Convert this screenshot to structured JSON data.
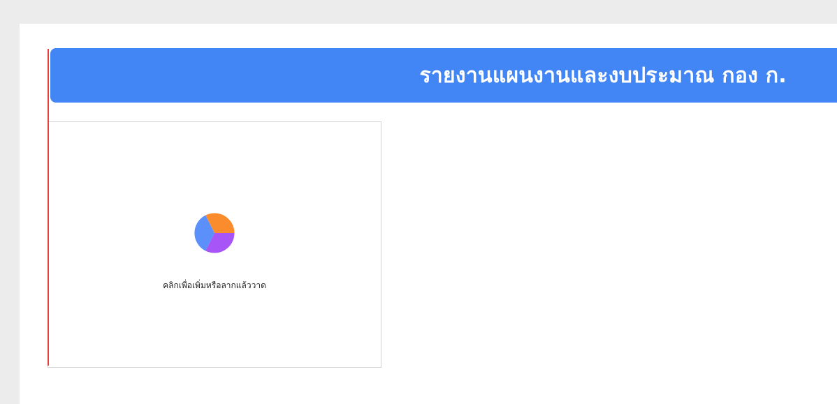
{
  "report": {
    "title": "รายงานแผนงานและงบประมาณ กอง ก."
  },
  "chart_placeholder": {
    "label": "คลิกเพื่อเพิ่มหรือลากแล้ววาด",
    "icon": "pie-chart-icon"
  },
  "colors": {
    "banner": "#4285f4",
    "guide_line": "#e8413a",
    "pie_orange": "#fb8c2d",
    "pie_purple": "#a855f7",
    "pie_blue": "#5b8ff9"
  }
}
